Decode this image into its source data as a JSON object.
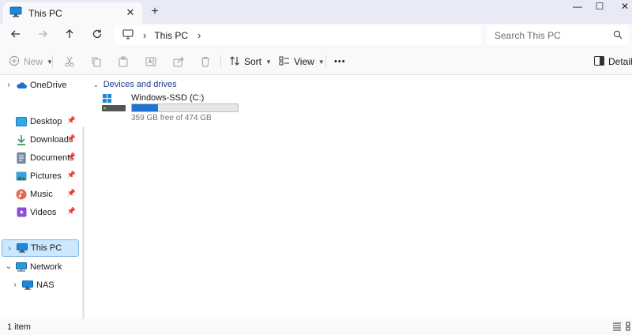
{
  "tab": {
    "title": "This PC",
    "close_glyph": "✕",
    "new_tab_glyph": "+"
  },
  "window_controls": {
    "minimize": "—",
    "maximize": "☐",
    "close": "✕"
  },
  "address": {
    "location": "This PC",
    "separator": "›",
    "trailing_chevron": "›"
  },
  "search": {
    "placeholder": "Search This PC"
  },
  "commands": {
    "new_label": "New",
    "sort_label": "Sort",
    "view_label": "View",
    "more_label": "•••",
    "details_label": "Details"
  },
  "sidebar": {
    "onedrive": "OneDrive",
    "quick_access": [
      "Desktop",
      "Downloads",
      "Documents",
      "Pictures",
      "Music",
      "Videos"
    ],
    "this_pc": "This PC",
    "network": "Network",
    "nas": "NAS"
  },
  "main": {
    "group_title": "Devices and drives",
    "drive": {
      "name": "Windows-SSD (C:)",
      "free_text": "359 GB free of 474 GB",
      "used_fraction": 0.243
    }
  },
  "status": {
    "items": "1 item"
  },
  "colors": {
    "accent": "#1e74d0",
    "selected_bg": "#cce8ff",
    "title_bg": "#e8eaf6"
  }
}
